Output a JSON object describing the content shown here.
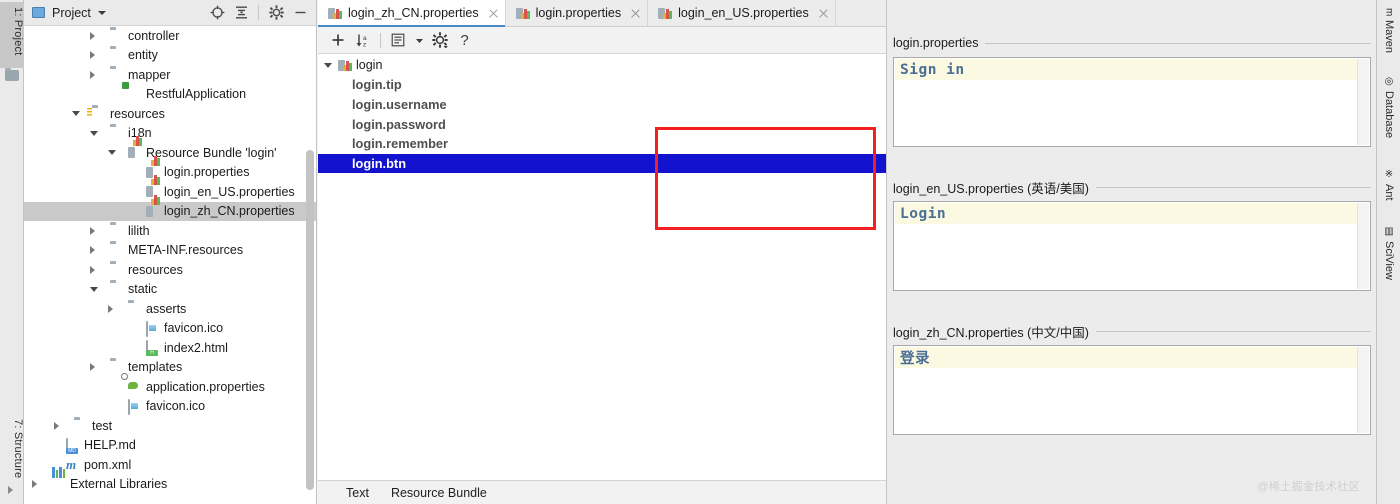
{
  "left_strip": {
    "tabs": [
      {
        "label": "1: Project",
        "active": true,
        "icon": "project-folder-icon"
      },
      {
        "label": "7: Structure",
        "active": false,
        "icon": "structure-icon"
      }
    ]
  },
  "project_panel": {
    "header": {
      "title": "Project",
      "icon": "project-icon",
      "caret": "chevron-down-icon",
      "actions": [
        {
          "name": "locate-icon",
          "title": "Select Opened File"
        },
        {
          "name": "collapse-all-icon",
          "title": "Collapse All"
        },
        {
          "name": "gear-icon",
          "title": "Settings"
        },
        {
          "name": "minimize-icon",
          "title": "Hide"
        }
      ]
    },
    "tree": [
      {
        "label": "controller",
        "icon": "folder-icon",
        "indent": 86,
        "twisty": "collapsed",
        "selected": false
      },
      {
        "label": "entity",
        "icon": "folder-icon",
        "indent": 86,
        "twisty": "collapsed",
        "selected": false
      },
      {
        "label": "mapper",
        "icon": "folder-icon",
        "indent": 86,
        "twisty": "collapsed",
        "selected": false
      },
      {
        "label": "RestfulApplication",
        "icon": "spring-app-icon",
        "indent": 104,
        "twisty": "none",
        "selected": false
      },
      {
        "label": "resources",
        "icon": "resources-folder-icon",
        "indent": 68,
        "twisty": "expanded",
        "selected": false
      },
      {
        "label": "i18n",
        "icon": "folder-icon",
        "indent": 86,
        "twisty": "expanded",
        "selected": false
      },
      {
        "label": "Resource Bundle 'login'",
        "icon": "properties-bundle-icon",
        "indent": 104,
        "twisty": "expanded",
        "selected": false
      },
      {
        "label": "login.properties",
        "icon": "properties-file-icon",
        "indent": 122,
        "twisty": "none",
        "selected": false
      },
      {
        "label": "login_en_US.properties",
        "icon": "properties-file-icon",
        "indent": 122,
        "twisty": "none",
        "selected": false
      },
      {
        "label": "login_zh_CN.properties",
        "icon": "properties-file-icon",
        "indent": 122,
        "twisty": "none",
        "selected": true
      },
      {
        "label": "lilith",
        "icon": "folder-icon",
        "indent": 86,
        "twisty": "collapsed",
        "selected": false
      },
      {
        "label": "META-INF.resources",
        "icon": "folder-icon",
        "indent": 86,
        "twisty": "collapsed",
        "selected": false
      },
      {
        "label": "resources",
        "icon": "folder-icon",
        "indent": 86,
        "twisty": "collapsed",
        "selected": false
      },
      {
        "label": "static",
        "icon": "folder-icon",
        "indent": 86,
        "twisty": "expanded",
        "selected": false
      },
      {
        "label": "asserts",
        "icon": "folder-icon",
        "indent": 104,
        "twisty": "collapsed",
        "selected": false
      },
      {
        "label": "favicon.ico",
        "icon": "ico-file-icon",
        "indent": 122,
        "twisty": "none",
        "selected": false
      },
      {
        "label": "index2.html",
        "icon": "html-file-icon",
        "indent": 122,
        "twisty": "none",
        "selected": false
      },
      {
        "label": "templates",
        "icon": "folder-icon",
        "indent": 86,
        "twisty": "collapsed",
        "selected": false
      },
      {
        "label": "application.properties",
        "icon": "spring-properties-icon",
        "indent": 104,
        "twisty": "none",
        "selected": false
      },
      {
        "label": "favicon.ico",
        "icon": "ico-file-icon",
        "indent": 104,
        "twisty": "none",
        "selected": false
      },
      {
        "label": "test",
        "icon": "folder-icon",
        "indent": 50,
        "twisty": "collapsed",
        "selected": false
      },
      {
        "label": "HELP.md",
        "icon": "markdown-file-icon",
        "indent": 42,
        "twisty": "none",
        "selected": false
      },
      {
        "label": "pom.xml",
        "icon": "maven-file-icon",
        "indent": 42,
        "twisty": "none",
        "selected": false
      },
      {
        "label": "External Libraries",
        "icon": "libraries-icon",
        "indent": 28,
        "twisty": "collapsed",
        "selected": false
      }
    ]
  },
  "editor_tabs": [
    {
      "label": "login_zh_CN.properties",
      "icon": "properties-file-icon",
      "active": true,
      "close": "close-icon"
    },
    {
      "label": "login.properties",
      "icon": "properties-file-icon",
      "active": false,
      "close": "close-icon"
    },
    {
      "label": "login_en_US.properties",
      "icon": "properties-file-icon",
      "active": false,
      "close": "close-icon"
    }
  ],
  "bundle_toolbar": [
    {
      "name": "add-property-button",
      "glyph": "+"
    },
    {
      "name": "sort-alphabetically-button",
      "glyph": "↓"
    },
    {
      "name": "group-keys-button",
      "glyph": "≣"
    },
    {
      "name": "view-options-dropdown",
      "glyph": "▾"
    },
    {
      "name": "settings-button",
      "glyph": "⚙"
    },
    {
      "name": "help-button",
      "glyph": "?"
    }
  ],
  "key_tree": {
    "root": {
      "label": "login",
      "icon": "properties-bundle-icon",
      "twisty": "expanded"
    },
    "keys": [
      {
        "label": "login.tip",
        "selected": false
      },
      {
        "label": "login.username",
        "selected": false
      },
      {
        "label": "login.password",
        "selected": false
      },
      {
        "label": "login.remember",
        "selected": false
      },
      {
        "label": "login.btn",
        "selected": true
      }
    ],
    "annotation": {
      "name": "red-highlight-box",
      "color": "#f41f1f"
    }
  },
  "bottom_tabs": [
    {
      "label": "Text",
      "active": false
    },
    {
      "label": "Resource Bundle",
      "active": true
    }
  ],
  "value_editors": [
    {
      "title": "login.properties",
      "value": "Sign in"
    },
    {
      "title": "login_en_US.properties (英语/美国)",
      "value": "Login"
    },
    {
      "title": "login_zh_CN.properties (中文/中国)",
      "value": "登录"
    }
  ],
  "right_strip": {
    "tabs": [
      {
        "label": "Maven",
        "icon": "maven-icon"
      },
      {
        "label": "Database",
        "icon": "database-icon"
      },
      {
        "label": "Ant",
        "icon": "ant-icon"
      },
      {
        "label": "SciView",
        "icon": "sciview-icon"
      }
    ]
  },
  "watermark": {
    "text": "@稀土掘金技术社区"
  },
  "colors": {
    "selection_blue": "#1212cf",
    "annotation_red": "#f41f1f",
    "value_text": "#4a6e96",
    "caret_line": "#fcf9e2",
    "active_tab_underline": "#4a88c7",
    "tree_selection_gray": "#c9c9c9"
  }
}
